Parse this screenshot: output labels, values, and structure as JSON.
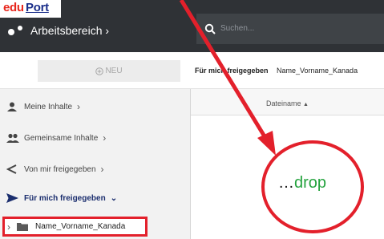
{
  "logo": {
    "part1": "edu",
    "part2": "Port"
  },
  "header": {
    "workspace_label": "Arbeitsbereich",
    "workspace_chevron": "›",
    "search_placeholder": "Suchen..."
  },
  "toolbar": {
    "new_label": "NEU"
  },
  "breadcrumb": {
    "items": [
      "Für mich freigegeben",
      "Name_Vorname_Kanada"
    ]
  },
  "table": {
    "column_header": "Dateiname",
    "sort_indicator": "▲"
  },
  "sidebar": {
    "items": [
      {
        "label": "Meine Inhalte",
        "icon": "person-icon",
        "chevron": "›"
      },
      {
        "label": "Gemeinsame Inhalte",
        "icon": "people-icon",
        "chevron": "›"
      },
      {
        "label": "Von mir freigegeben",
        "icon": "share-icon",
        "chevron": "›"
      },
      {
        "label": "Für mich freigegeben",
        "icon": "send-icon",
        "chevron": "⌄",
        "active": true
      }
    ],
    "folder": {
      "label": "Name_Vorname_Kanada",
      "expander": "›",
      "icon": "folder-icon"
    }
  },
  "annotation": {
    "dots": "…",
    "word": "drop",
    "color": "#e3202b",
    "text_color": "#23a23d"
  },
  "colors": {
    "header_bg": "#2f3236",
    "accent_blue": "#1b2e6e",
    "annotation_red": "#e3202b"
  }
}
